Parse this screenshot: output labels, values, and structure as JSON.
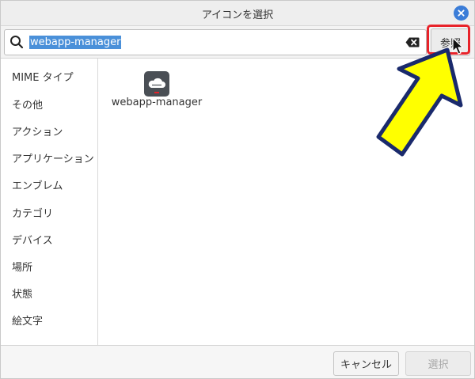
{
  "dialog": {
    "title": "アイコンを選択",
    "close_icon": "close-icon",
    "accent_color": "#3b7dd8"
  },
  "search": {
    "value": "webapp-manager",
    "search_icon": "search-icon",
    "clear_icon": "clear-text-icon",
    "browse_label": "参照",
    "selection_color": "#4a90d9"
  },
  "sidebar": {
    "items": [
      {
        "label": "MIME タイプ"
      },
      {
        "label": "その他"
      },
      {
        "label": "アクション"
      },
      {
        "label": "アプリケーション"
      },
      {
        "label": "エンブレム"
      },
      {
        "label": "カテゴリ"
      },
      {
        "label": "デバイス"
      },
      {
        "label": "場所"
      },
      {
        "label": "状態"
      },
      {
        "label": "絵文字"
      }
    ]
  },
  "icons": [
    {
      "label": "webapp-manager",
      "icon": "webapp-manager-cloud-icon"
    }
  ],
  "footer": {
    "cancel_label": "キャンセル",
    "select_label": "選択"
  },
  "annotations": {
    "highlight_color": "#e8232a",
    "arrow_color": "#ffff00",
    "arrow_outline": "#1a2a6c"
  }
}
